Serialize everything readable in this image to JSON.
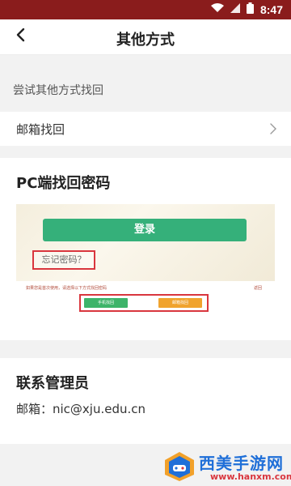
{
  "status_bar": {
    "time": "8:47",
    "background_color": "#8a1c1c"
  },
  "header": {
    "back_icon": "chevron-left-icon",
    "title": "其他方式"
  },
  "hint": {
    "text": "尝试其他方式找回"
  },
  "email_recovery": {
    "label": "邮箱找回",
    "chevron_icon": "chevron-right-icon"
  },
  "pc_recovery": {
    "heading": "PC端找回密码",
    "screenshot": {
      "login_button": "登录",
      "forgot_password": "忘记密码？",
      "instruction": "如果您是首次使用，请选择以下方式找回密码",
      "right_note": "返回",
      "option_green": "手机找回",
      "option_orange": "邮箱找回"
    }
  },
  "admin": {
    "heading": "联系管理员",
    "email_line": "邮箱：nic@xju.edu.cn"
  },
  "watermark": {
    "name": "西美手游网",
    "url": "www.hanxm.com"
  }
}
